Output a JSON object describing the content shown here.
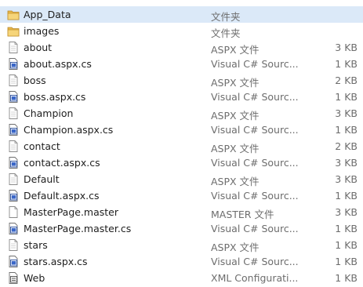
{
  "files": [
    {
      "name": "App_Data",
      "type": "文件夹",
      "size": "",
      "icon": "folder-icon",
      "selected": true
    },
    {
      "name": "images",
      "type": "文件夹",
      "size": "",
      "icon": "folder-icon",
      "selected": false
    },
    {
      "name": "about",
      "type": "ASPX 文件",
      "size": "3 KB",
      "icon": "page-icon",
      "selected": false
    },
    {
      "name": "about.aspx.cs",
      "type": "Visual C# Sourc...",
      "size": "1 KB",
      "icon": "cs-file-icon",
      "selected": false
    },
    {
      "name": "boss",
      "type": "ASPX 文件",
      "size": "2 KB",
      "icon": "page-icon",
      "selected": false
    },
    {
      "name": "boss.aspx.cs",
      "type": "Visual C# Sourc...",
      "size": "1 KB",
      "icon": "cs-file-icon",
      "selected": false
    },
    {
      "name": "Champion",
      "type": "ASPX 文件",
      "size": "3 KB",
      "icon": "page-icon",
      "selected": false
    },
    {
      "name": "Champion.aspx.cs",
      "type": "Visual C# Sourc...",
      "size": "1 KB",
      "icon": "cs-file-icon",
      "selected": false
    },
    {
      "name": "contact",
      "type": "ASPX 文件",
      "size": "2 KB",
      "icon": "page-icon",
      "selected": false
    },
    {
      "name": "contact.aspx.cs",
      "type": "Visual C# Sourc...",
      "size": "3 KB",
      "icon": "cs-file-icon",
      "selected": false
    },
    {
      "name": "Default",
      "type": "ASPX 文件",
      "size": "3 KB",
      "icon": "page-icon",
      "selected": false
    },
    {
      "name": "Default.aspx.cs",
      "type": "Visual C# Sourc...",
      "size": "1 KB",
      "icon": "cs-file-icon",
      "selected": false
    },
    {
      "name": "MasterPage.master",
      "type": "MASTER 文件",
      "size": "3 KB",
      "icon": "blank-file-icon",
      "selected": false
    },
    {
      "name": "MasterPage.master.cs",
      "type": "Visual C# Sourc...",
      "size": "1 KB",
      "icon": "cs-file-icon",
      "selected": false
    },
    {
      "name": "stars",
      "type": "ASPX 文件",
      "size": "1 KB",
      "icon": "page-icon",
      "selected": false
    },
    {
      "name": "stars.aspx.cs",
      "type": "Visual C# Sourc...",
      "size": "1 KB",
      "icon": "cs-file-icon",
      "selected": false
    },
    {
      "name": "Web",
      "type": "XML Configurati...",
      "size": "1 KB",
      "icon": "config-file-icon",
      "selected": false
    }
  ]
}
